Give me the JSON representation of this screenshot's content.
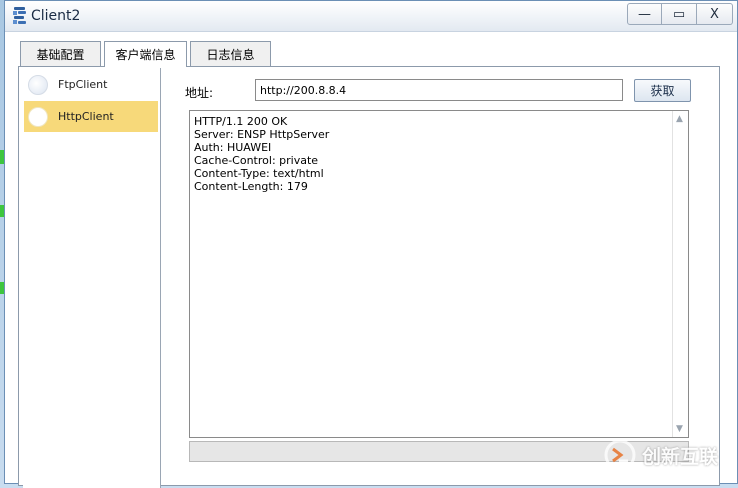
{
  "window": {
    "title": "Client2",
    "minimize_glyph": "—",
    "maximize_glyph": "▭",
    "close_glyph": "X"
  },
  "tabs": [
    {
      "label": "基础配置",
      "active": false
    },
    {
      "label": "客户端信息",
      "active": true
    },
    {
      "label": "日志信息",
      "active": false
    }
  ],
  "sidebar": {
    "items": [
      {
        "label": "FtpClient",
        "selected": false
      },
      {
        "label": "HttpClient",
        "selected": true
      }
    ]
  },
  "http": {
    "address_label": "地址:",
    "address_value": "http://200.8.8.4",
    "fetch_label": "获取",
    "response_lines": [
      "HTTP/1.1 200 OK",
      "Server: ENSP HttpServer",
      "Auth: HUAWEI",
      "Cache-Control: private",
      "Content-Type: text/html",
      "Content-Length: 179"
    ]
  },
  "progress": {
    "value": 0
  },
  "watermark": {
    "text": "创新互联"
  },
  "colors": {
    "selected_item": "#f7d97a",
    "titlebar": "#eef2f7",
    "accent_green": "#3ec63e"
  },
  "icons": {
    "app": "network-client-icon",
    "minimize": "minimize-icon",
    "maximize": "maximize-icon",
    "close": "close-icon"
  }
}
